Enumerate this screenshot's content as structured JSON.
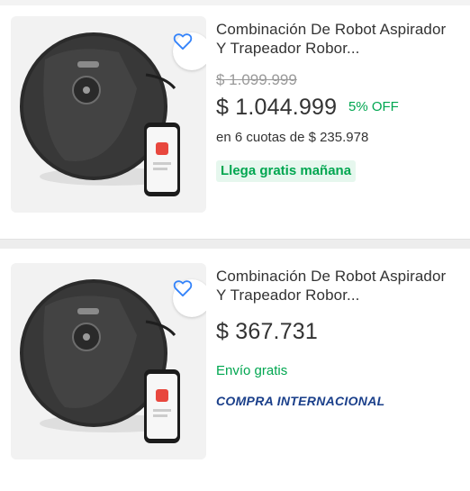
{
  "colors": {
    "green": "#00a650",
    "blue_accent": "#3483fa",
    "intl_blue": "#1a3f8a",
    "text": "#333333",
    "muted": "#999999"
  },
  "products": [
    {
      "title": "Combinación De Robot Aspirador Y Trapeador Robor...",
      "old_price": "$ 1.099.999",
      "price": "$ 1.044.999",
      "discount": "5% OFF",
      "installments": "en 6 cuotas de $ 235.978",
      "shipping_badge": "Llega gratis mañana",
      "favorite_icon": "heart-outline-icon"
    },
    {
      "title": "Combinación De Robot Aspirador Y Trapeador Robor...",
      "price": "$ 367.731",
      "shipping": "Envío gratis",
      "international": "COMPRA INTERNACIONAL",
      "favorite_icon": "heart-outline-icon"
    }
  ]
}
